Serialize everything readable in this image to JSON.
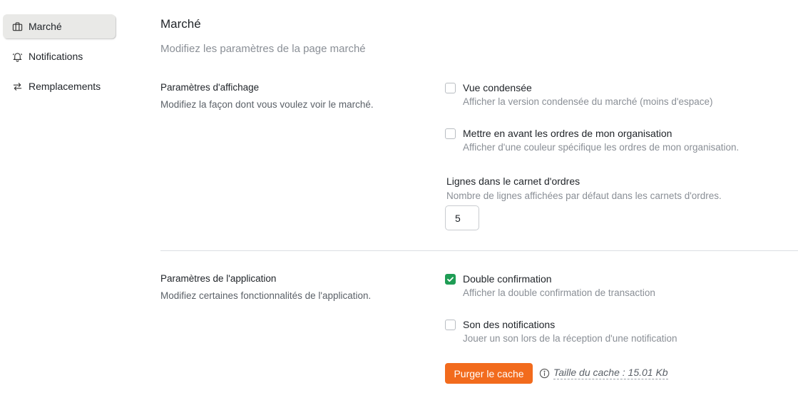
{
  "sidebar": {
    "items": [
      {
        "label": "Marché",
        "icon": "briefcase-icon",
        "active": true
      },
      {
        "label": "Notifications",
        "icon": "bell-icon",
        "active": false
      },
      {
        "label": "Remplacements",
        "icon": "swap-arrows-icon",
        "active": false
      }
    ]
  },
  "page": {
    "title": "Marché",
    "subtitle": "Modifiez les paramètres de la page marché"
  },
  "display_section": {
    "title": "Paramètres d'affichage",
    "description": "Modifiez la façon dont vous voulez voir le marché.",
    "options": [
      {
        "label": "Vue condensée",
        "description": "Afficher la version condensée du marché (moins d'espace)",
        "checked": false
      },
      {
        "label": "Mettre en avant les ordres de mon organisation",
        "description": "Afficher d'une couleur spécifique les ordres de mon organisation.",
        "checked": false
      }
    ],
    "orderbook_rows": {
      "label": "Lignes dans le carnet d'ordres",
      "description": "Nombre de lignes affichées par défaut dans les carnets d'ordres.",
      "value": "5"
    }
  },
  "app_section": {
    "title": "Paramètres de l'application",
    "description": "Modifiez certaines fonctionnalités de l'application.",
    "options": [
      {
        "label": "Double confirmation",
        "description": "Afficher la double confirmation de transaction",
        "checked": true
      },
      {
        "label": "Son des notifications",
        "description": "Jouer un son lors de la réception d'une notification",
        "checked": false
      }
    ],
    "purge_button_label": "Purger le cache",
    "cache_size_text": "Taille du cache : 15.01 Kb"
  },
  "colors": {
    "accent_orange": "#f26b1d",
    "checkbox_green": "#1f9d55",
    "active_nav_bg": "#e9e9e7"
  }
}
